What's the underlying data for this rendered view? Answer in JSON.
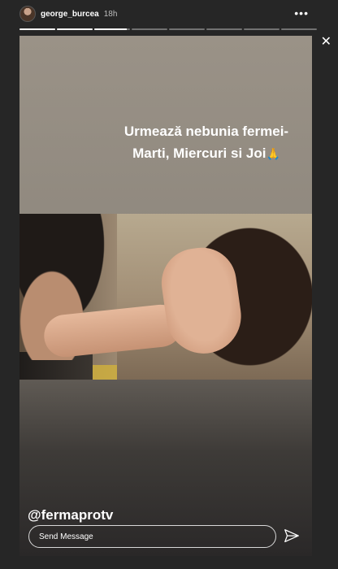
{
  "header": {
    "username": "george_burcea",
    "time": "18h",
    "more_label": "•••",
    "close_label": "✕"
  },
  "progress": {
    "segments": 8,
    "current_index": 2,
    "current_fill": 0.9
  },
  "story": {
    "caption": "Urmează nebunia fermei- Marti, Miercuri si Joi",
    "emoji": "🙏",
    "mention": "@fermaprotv"
  },
  "reply": {
    "placeholder": "Send Message"
  },
  "icons": {
    "more": "more-horizontal-icon",
    "close": "close-icon",
    "send": "paper-plane-send-icon"
  }
}
